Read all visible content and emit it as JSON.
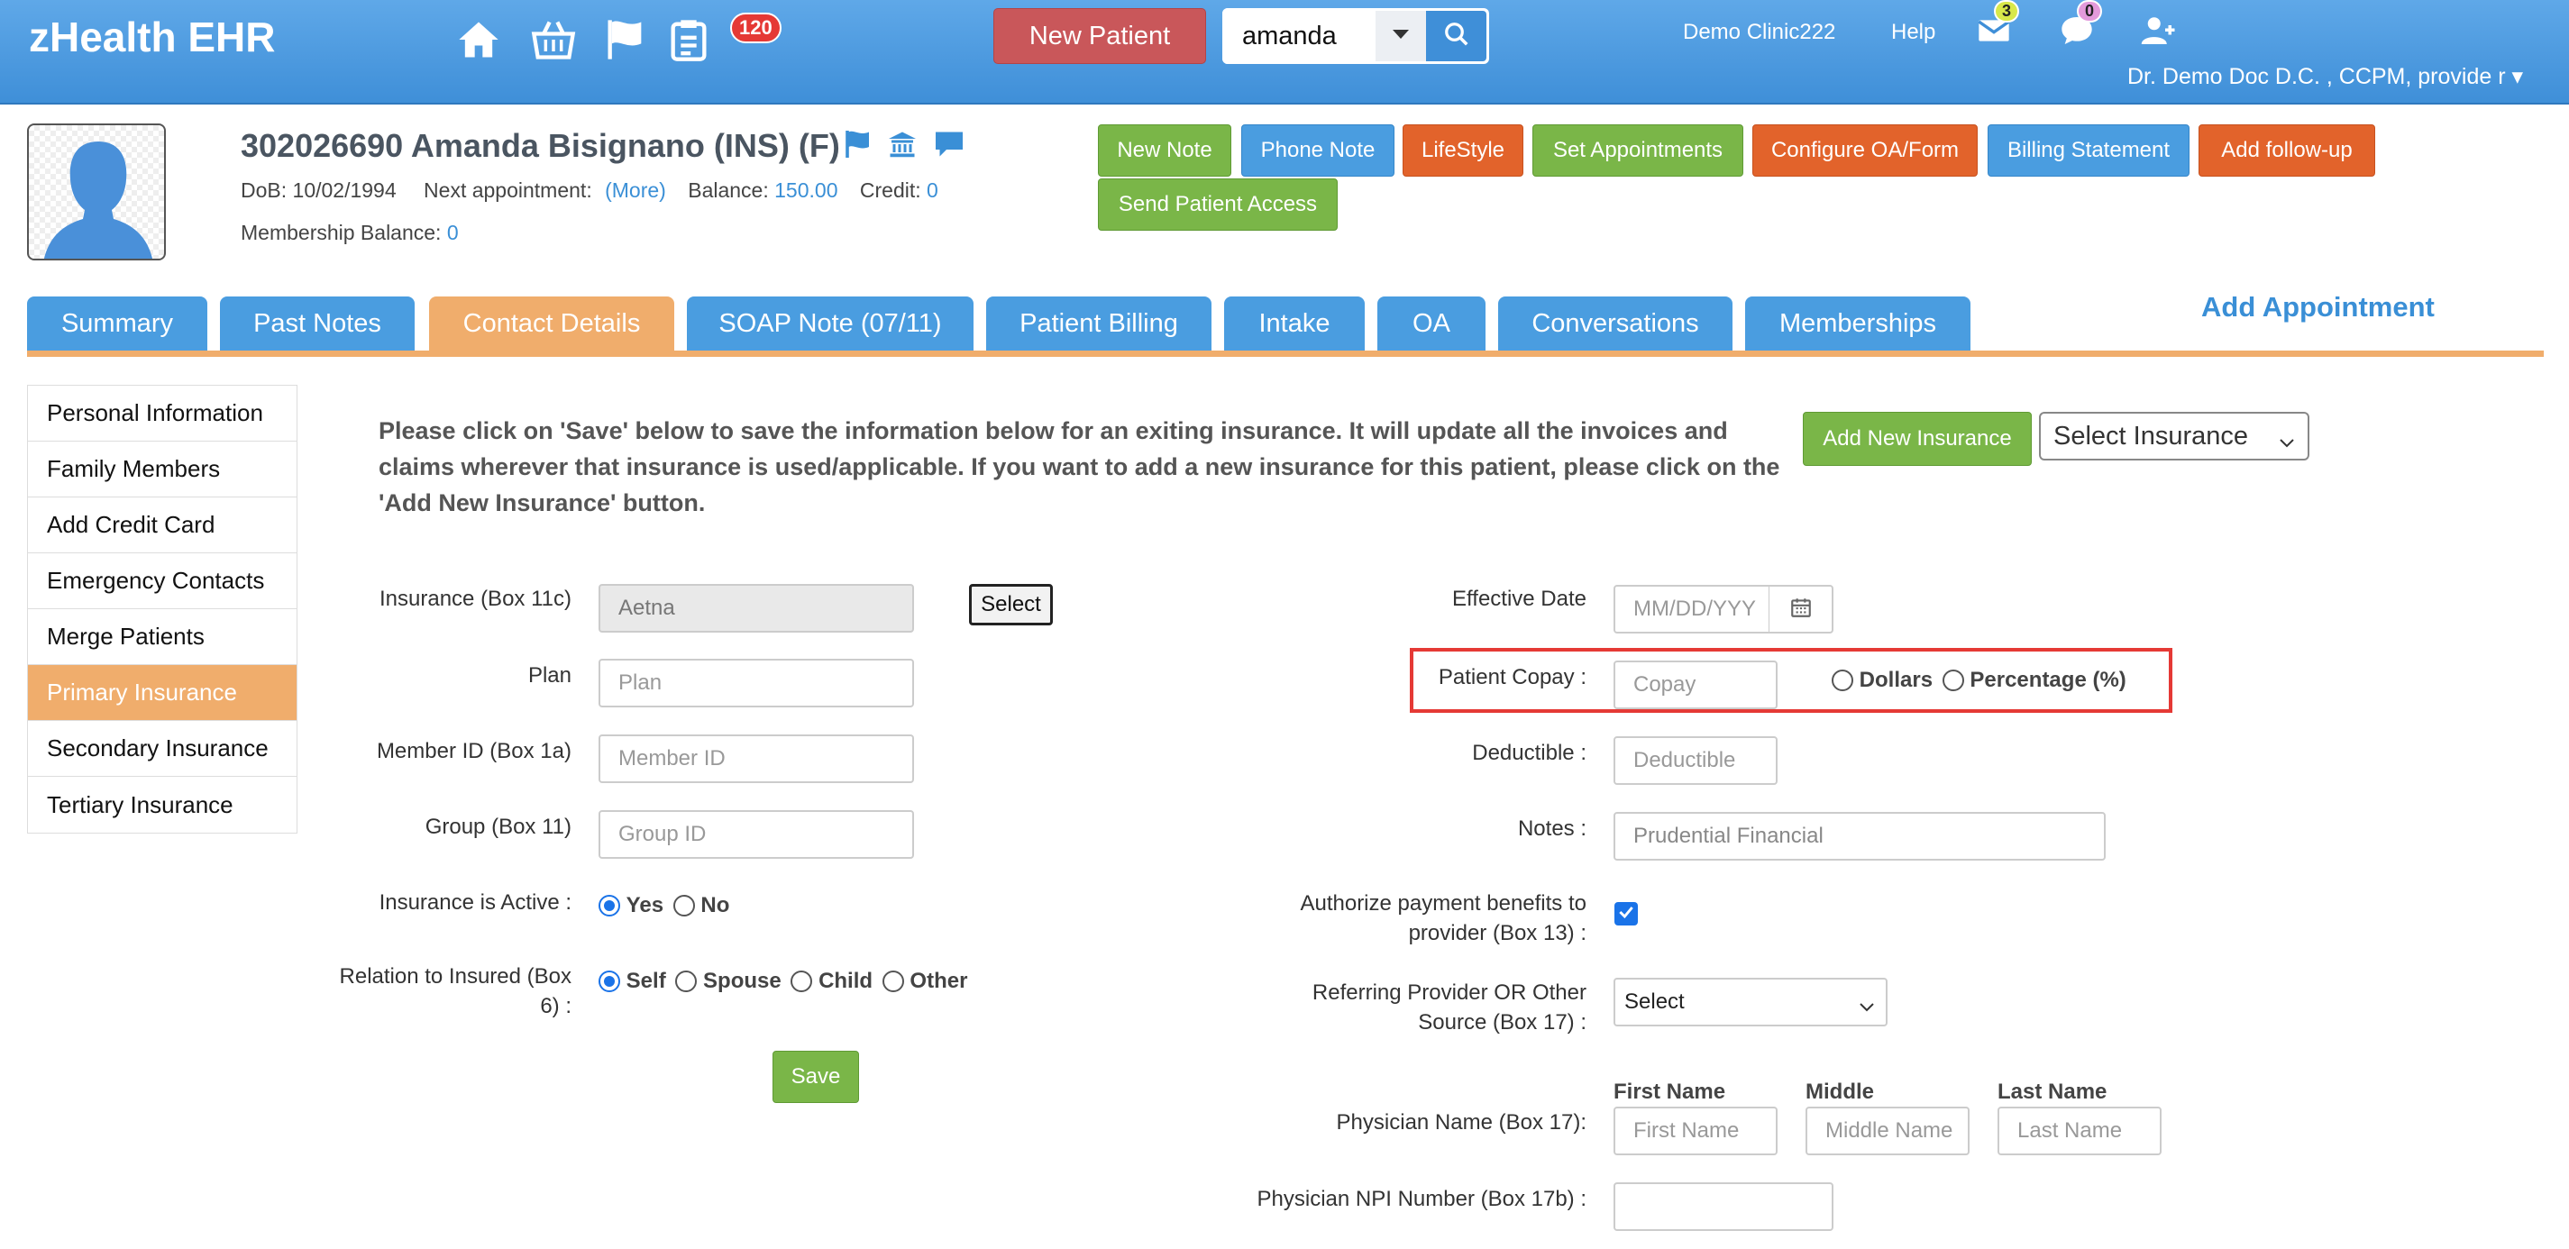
{
  "app": {
    "title": "zHealth EHR",
    "tasks_badge": "120",
    "new_patient_label": "New Patient",
    "search_value": "amanda",
    "clinic_label": "Demo Clinic222",
    "help_label": "Help",
    "messages_badge": "3",
    "chat_badge": "0",
    "user_label": "Dr. Demo Doc D.C. , CCPM, provide r",
    "icons": [
      "home-icon",
      "basket-icon",
      "flag-icon",
      "clipboard-icon",
      "envelope-icon",
      "chat-icon",
      "add-user-icon",
      "search-icon",
      "chevron-down-icon"
    ]
  },
  "patient": {
    "title": "302026690 Amanda Bisignano  (INS) (F)",
    "dob_label": "DoB:",
    "dob": "10/02/1994",
    "next_appt_label": "Next appointment:",
    "next_appt_link": "(More)",
    "balance_label": "Balance:",
    "balance": "150.00",
    "credit_label": "Credit:",
    "credit": "0",
    "membership_label": "Membership Balance:",
    "membership_balance": "0"
  },
  "actions": {
    "new_note": "New Note",
    "phone_note": "Phone Note",
    "lifestyle": "LifeStyle",
    "set_appointments": "Set Appointments",
    "configure_oa": "Configure OA/Form",
    "billing_statement": "Billing Statement",
    "add_follow_up": "Add follow-up",
    "send_patient_access": "Send Patient Access"
  },
  "tabs": {
    "summary": "Summary",
    "past_notes": "Past Notes",
    "contact_details": "Contact Details",
    "soap_note": "SOAP Note (07/11)",
    "patient_billing": "Patient Billing",
    "intake": "Intake",
    "oa": "OA",
    "conversations": "Conversations",
    "memberships": "Memberships",
    "add_appointment": "Add Appointment"
  },
  "sidebar": {
    "items": [
      "Personal Information",
      "Family Members",
      "Add Credit Card",
      "Emergency Contacts",
      "Merge Patients",
      "Primary Insurance",
      "Secondary Insurance",
      "Tertiary Insurance"
    ],
    "active_index": 5
  },
  "insurance": {
    "info_message": "Please click on 'Save' below to save the information below for an exiting insurance. It will update all the invoices and claims wherever that insurance is used/applicable. If you want to add a new insurance for this patient, please click on the 'Add New Insurance' button.",
    "add_new_label": "Add New Insurance",
    "select_insurance": "Select Insurance",
    "left": {
      "insurance_label": "Insurance (Box 11c)",
      "insurance_value": "Aetna",
      "select_button": "Select",
      "plan_label": "Plan",
      "plan_placeholder": "Plan",
      "member_label": "Member ID (Box 1a)",
      "member_placeholder": "Member ID",
      "group_label": "Group (Box 11)",
      "group_placeholder": "Group ID",
      "active_label": "Insurance is Active :",
      "active_options": [
        "Yes",
        "No"
      ],
      "relation_label": "Relation to Insured (Box 6) :",
      "relation_options": [
        "Self",
        "Spouse",
        "Child",
        "Other"
      ],
      "save_label": "Save"
    },
    "right": {
      "effective_label": "Effective Date",
      "effective_placeholder": "MM/DD/YYY",
      "copay_label": "Patient Copay :",
      "copay_placeholder": "Copay",
      "copay_options": [
        "Dollars",
        "Percentage (%)"
      ],
      "deductible_label": "Deductible :",
      "deductible_placeholder": "Deductible",
      "notes_label": "Notes :",
      "notes_value": "Prudential Financial",
      "authorize_label": "Authorize payment benefits to provider (Box 13) :",
      "referring_label": "Referring Provider OR Other Source (Box 17) :",
      "referring_value": "Select",
      "physician_label": "Physician Name (Box 17):",
      "first_name_header": "First Name",
      "middle_header": "Middle",
      "last_name_header": "Last Name",
      "first_name_placeholder": "First Name",
      "middle_placeholder": "Middle Name",
      "last_name_placeholder": "Last Name",
      "npi_label": "Physician NPI Number (Box 17b) :"
    }
  },
  "colors": {
    "topbar": "#4a9de0",
    "active_tab": "#f0ad6c",
    "highlight": "#e53935",
    "green": "#7ab648",
    "orange": "#e2632b"
  }
}
